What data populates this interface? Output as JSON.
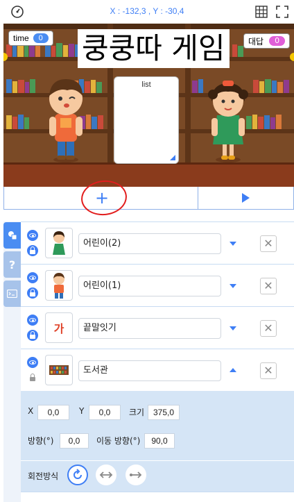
{
  "toolbar": {
    "coords": "X : -132,3 , Y : -30,4",
    "speed_icon": "speedometer-icon",
    "grid_icon": "grid-icon",
    "fullscreen_icon": "fullscreen-icon"
  },
  "stage": {
    "title": "쿵쿵따 게임",
    "time_label": "time",
    "time_value": "0",
    "answer_label": "대답",
    "answer_value": "0",
    "list_title": "list"
  },
  "actions": {
    "add_symbol": "+",
    "play_icon": "play-icon"
  },
  "sidetabs": [
    {
      "name": "objects-tab"
    },
    {
      "name": "help-tab",
      "label": "?"
    },
    {
      "name": "console-tab"
    }
  ],
  "objects": [
    {
      "name": "어린이(2)",
      "thumb": "girl"
    },
    {
      "name": "어린이(1)",
      "thumb": "boy"
    },
    {
      "name": "끝말잇기",
      "thumb": "text",
      "thumb_text": "가"
    },
    {
      "name": "도서관",
      "thumb": "library"
    }
  ],
  "properties": {
    "x_label": "X",
    "x_value": "0,0",
    "y_label": "Y",
    "y_value": "0,0",
    "size_label": "크기",
    "size_value": "375,0",
    "direction_label": "방향(°)",
    "direction_value": "0,0",
    "move_direction_label": "이동 방향(°)",
    "move_direction_value": "90,0",
    "rotation_label": "회전방식"
  },
  "colors": {
    "accent": "#3e7ef5",
    "highlight_circle": "#e21d1d",
    "panel": "#d5e5f6"
  }
}
